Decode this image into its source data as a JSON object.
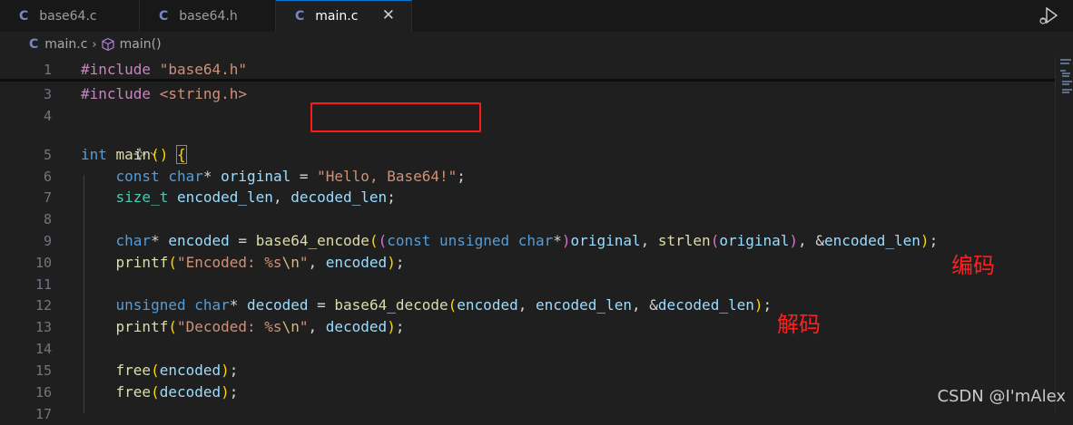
{
  "tabs": [
    {
      "icon": "C",
      "label": "base64.c",
      "active": false
    },
    {
      "icon": "C",
      "label": "base64.h",
      "active": false
    },
    {
      "icon": "C",
      "label": "main.c",
      "active": true
    }
  ],
  "breadcrumb": {
    "icon": "C",
    "file": "main.c",
    "symbol": "main()"
  },
  "editor": {
    "line_numbers": [
      "1",
      "3",
      "4",
      "5",
      "6",
      "7",
      "8",
      "9",
      "10",
      "11",
      "12",
      "13",
      "14",
      "15",
      "16",
      "17"
    ],
    "code": {
      "l1": {
        "directive": "#include",
        "header": "\"base64.h\""
      },
      "l3": {
        "directive": "#include",
        "header": "<string.h>"
      },
      "l5": {
        "type": "int",
        "fn": "main",
        "parens": "()",
        "brace": "{"
      },
      "l6": {
        "kw1": "const",
        "kw2": "char",
        "star": "*",
        "var": "original",
        "eq": "=",
        "str": "\"Hello, Base64!\"",
        "semi": ";"
      },
      "l7": {
        "type": "size_t",
        "var1": "encoded_len",
        "comma": ",",
        "var2": "decoded_len",
        "semi": ";"
      },
      "l9": {
        "kw": "char",
        "star": "*",
        "var": "encoded",
        "eq": "=",
        "fn": "base64_encode",
        "cast_kw1": "const",
        "cast_kw2": "unsigned",
        "cast_kw3": "char",
        "cast_star": "*",
        "arg1": "original",
        "fn2": "strlen",
        "arg2": "original",
        "amp": "&",
        "arg3": "encoded_len",
        "semi": ";"
      },
      "l10": {
        "fn": "printf",
        "str1": "\"Encoded: %s",
        "esc": "\\n",
        "str2": "\"",
        "arg": "encoded",
        "semi": ";"
      },
      "l12": {
        "kw1": "unsigned",
        "kw2": "char",
        "star": "*",
        "var": "decoded",
        "eq": "=",
        "fn": "base64_decode",
        "arg1": "encoded",
        "arg2": "encoded_len",
        "amp": "&",
        "arg3": "decoded_len",
        "semi": ";"
      },
      "l13": {
        "fn": "printf",
        "str1": "\"Decoded: %s",
        "esc": "\\n",
        "str2": "\"",
        "arg": "decoded",
        "semi": ";"
      },
      "l15": {
        "fn": "free",
        "arg": "encoded",
        "semi": ";"
      },
      "l16": {
        "fn": "free",
        "arg": "decoded",
        "semi": ";"
      }
    }
  },
  "annotations": {
    "encode": "编码",
    "decode": "解码"
  },
  "watermark": "CSDN @I'mAlex",
  "colors": {
    "highlight_box": "#ff1a1a",
    "annotation_text": "#ff2020",
    "active_tab_accent": "#0078d4"
  },
  "icons": {
    "tab_close": "close-icon",
    "run": "run-debug-icon",
    "breadcrumb_symbol": "cube-icon",
    "codelens": "sparkle-icon"
  }
}
